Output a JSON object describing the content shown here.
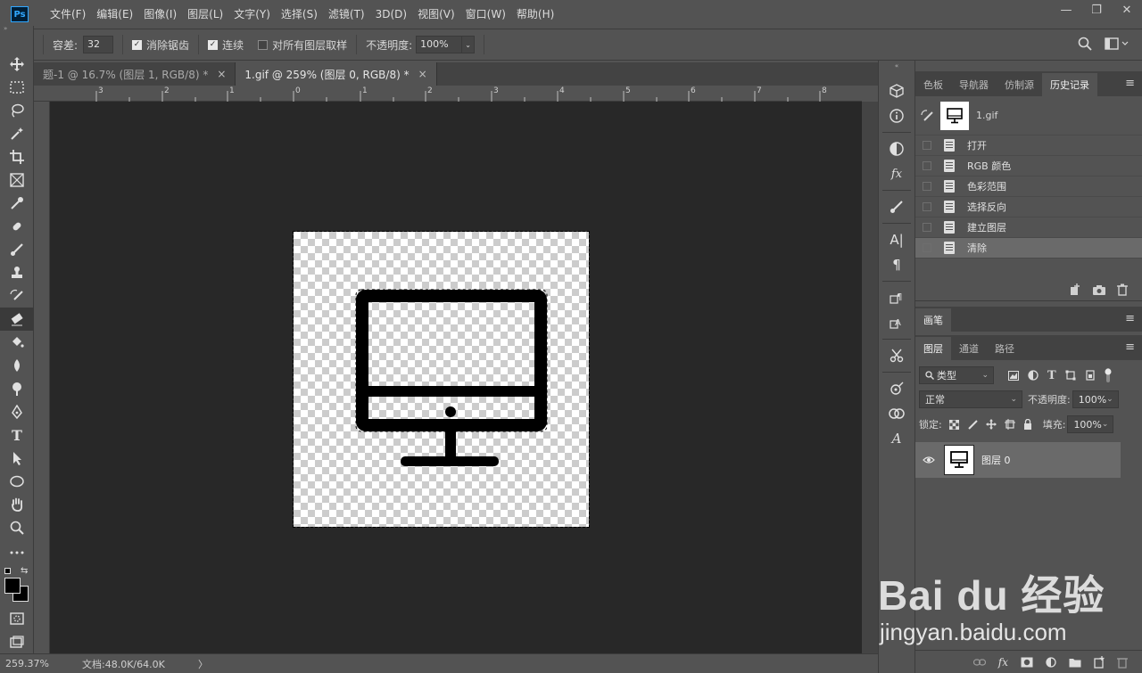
{
  "app": {
    "logo": "Ps"
  },
  "menu": [
    "文件(F)",
    "编辑(E)",
    "图像(I)",
    "图层(L)",
    "文字(Y)",
    "选择(S)",
    "滤镜(T)",
    "3D(D)",
    "视图(V)",
    "窗口(W)",
    "帮助(H)"
  ],
  "window_controls": {
    "minimize": "—",
    "restore": "❐",
    "close": "✕"
  },
  "options": {
    "tolerance_label": "容差:",
    "tolerance_value": "32",
    "antialias_label": "消除锯齿",
    "contiguous_label": "连续",
    "all_layers_label": "对所有图层取样",
    "opacity_label": "不透明度:",
    "opacity_value": "100%"
  },
  "tabs": [
    {
      "label": "题-1 @ 16.7% (图层 1, RGB/8) *",
      "close": "×"
    },
    {
      "label": "1.gif @ 259% (图层 0, RGB/8) *",
      "close": "×"
    }
  ],
  "ruler_ticks": [
    "3",
    "2",
    "1",
    "0",
    "1",
    "2",
    "3",
    "4",
    "5",
    "6",
    "7",
    "8"
  ],
  "status": {
    "zoom": "259.37%",
    "doc_info": "文档:48.0K/64.0K",
    "arrow": "〉"
  },
  "history_panel": {
    "tabs": [
      "色板",
      "导航器",
      "仿制源",
      "历史记录"
    ],
    "snapshot_name": "1.gif",
    "items": [
      "打开",
      "RGB 颜色",
      "色彩范围",
      "选择反向",
      "建立图层",
      "清除"
    ]
  },
  "brush_panel": {
    "tab": "画笔"
  },
  "layers_panel": {
    "tabs": [
      "图层",
      "通道",
      "路径"
    ],
    "filter_label": "类型",
    "blend_mode": "正常",
    "opacity_label": "不透明度:",
    "opacity_value": "100%",
    "lock_label": "锁定:",
    "fill_label": "填充:",
    "fill_value": "100%",
    "layer_name": "图层 0"
  },
  "watermark": {
    "main": "Bai du 经验",
    "sub": "jingyan.baidu.com"
  }
}
